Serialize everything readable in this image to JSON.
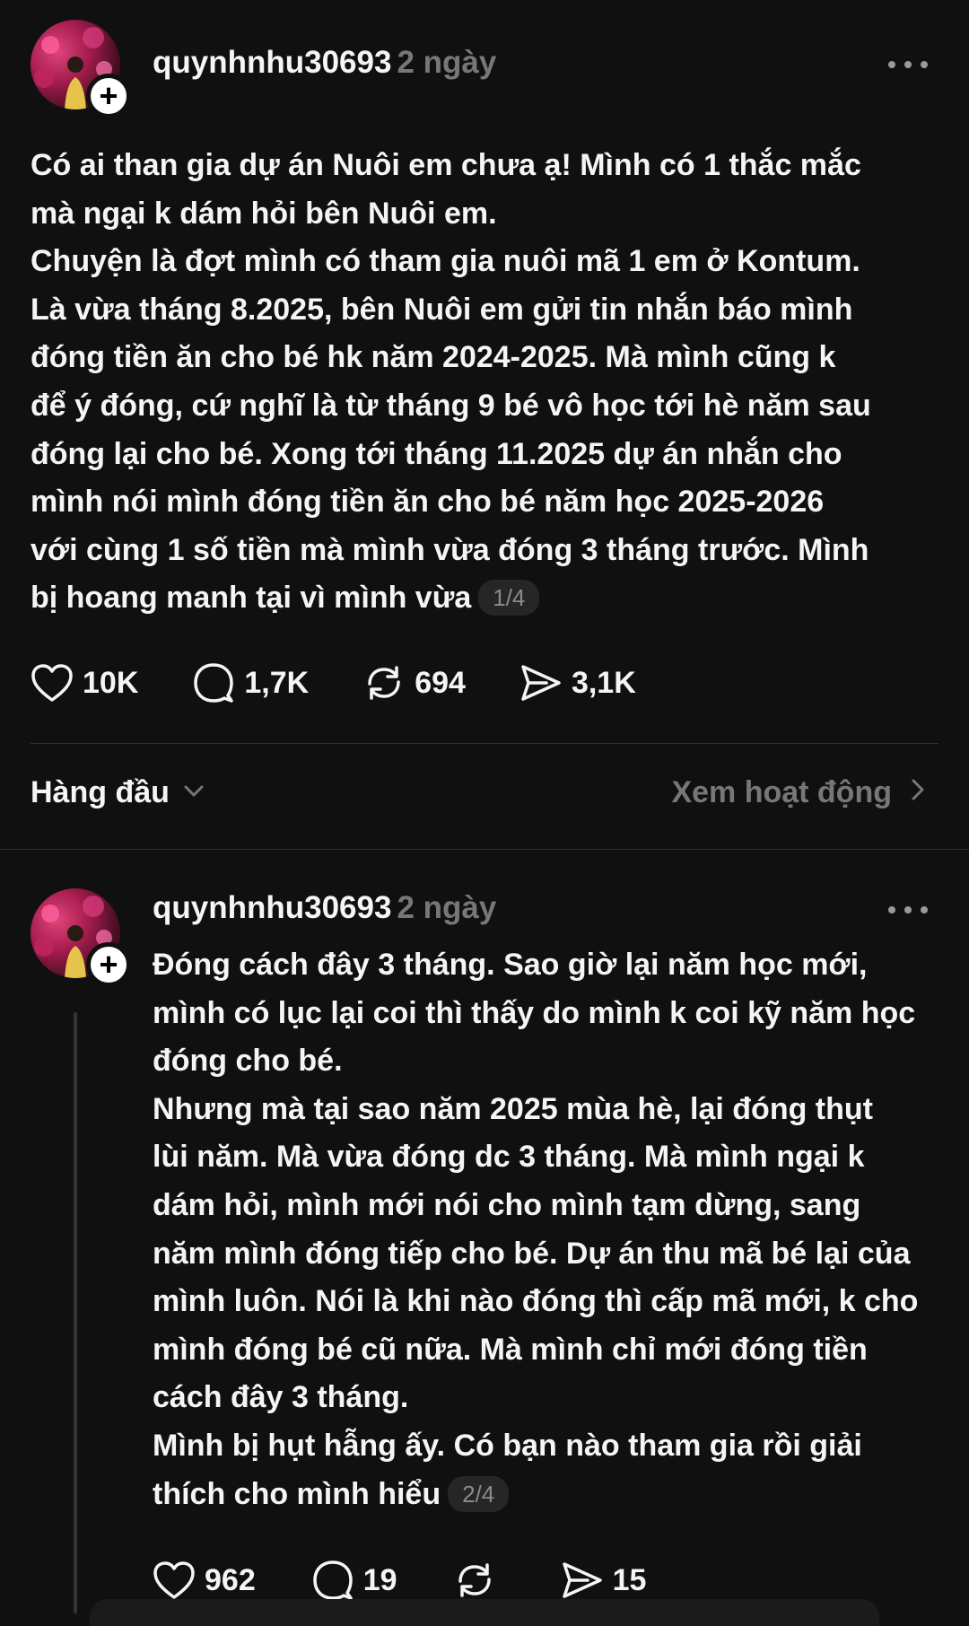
{
  "post": {
    "username": "quynhnhu30693",
    "time": "2 ngày",
    "body": "Có ai than gia dự án Nuôi em chưa ạ! Mình có 1 thắc mắc\nmà ngại k dám hỏi bên Nuôi em.\nChuyện là đợt mình có tham gia nuôi mã 1 em ở Kontum.\nLà vừa tháng 8.2025, bên Nuôi em gửi tin nhắn báo mình\nđóng tiền ăn cho bé hk năm 2024-2025. Mà mình cũng k\nđể ý đóng, cứ nghĩ là từ tháng 9 bé vô học tới hè năm sau\nđóng lại cho bé. Xong tới tháng 11.2025 dự án nhắn cho\nmình nói mình đóng tiền ăn cho bé năm học 2025-2026\nvới cùng 1 số tiền mà mình vừa đóng 3 tháng trước. Mình\nbị hoang manh tại vì mình vừa",
    "page_indicator": "1/4",
    "likes": "10K",
    "comments": "1,7K",
    "reposts": "694",
    "shares": "3,1K"
  },
  "sort": {
    "label": "Hàng đầu",
    "activity_link": "Xem hoạt động"
  },
  "reply": {
    "username": "quynhnhu30693",
    "time": "2 ngày",
    "body": "Đóng cách đây 3 tháng. Sao giờ lại năm học mới,\nmình có lục lại coi thì thấy do mình k coi kỹ năm học\nđóng cho bé.\nNhưng mà tại sao năm 2025 mùa hè, lại đóng thụt\nlùi năm. Mà vừa đóng dc 3 tháng. Mà mình ngại k\ndám hỏi, mình mới nói cho mình tạm dừng, sang\nnăm mình đóng tiếp cho bé. Dự án thu mã bé lại của\nmình luôn. Nói là khi nào đóng thì cấp mã mới, k cho\nmình đóng bé cũ nữa. Mà mình chỉ mới đóng tiền\ncách đây 3 tháng.\nMình bị hụt hẫng ấy. Có bạn nào tham gia rồi giải\nthích cho mình hiểu",
    "page_indicator": "2/4",
    "likes": "962",
    "comments": "19",
    "reposts": "",
    "shares": "15"
  },
  "icons": {
    "like": "heart-icon",
    "comment": "comment-bubble-icon",
    "repost": "repost-icon",
    "share": "send-icon",
    "more": "more-dots-icon",
    "follow": "plus-icon",
    "chevron_down": "chevron-down-icon",
    "chevron_right": "chevron-right-icon"
  },
  "colors": {
    "background": "#101010",
    "text_primary": "#f3f5f7",
    "text_secondary": "#777777"
  }
}
